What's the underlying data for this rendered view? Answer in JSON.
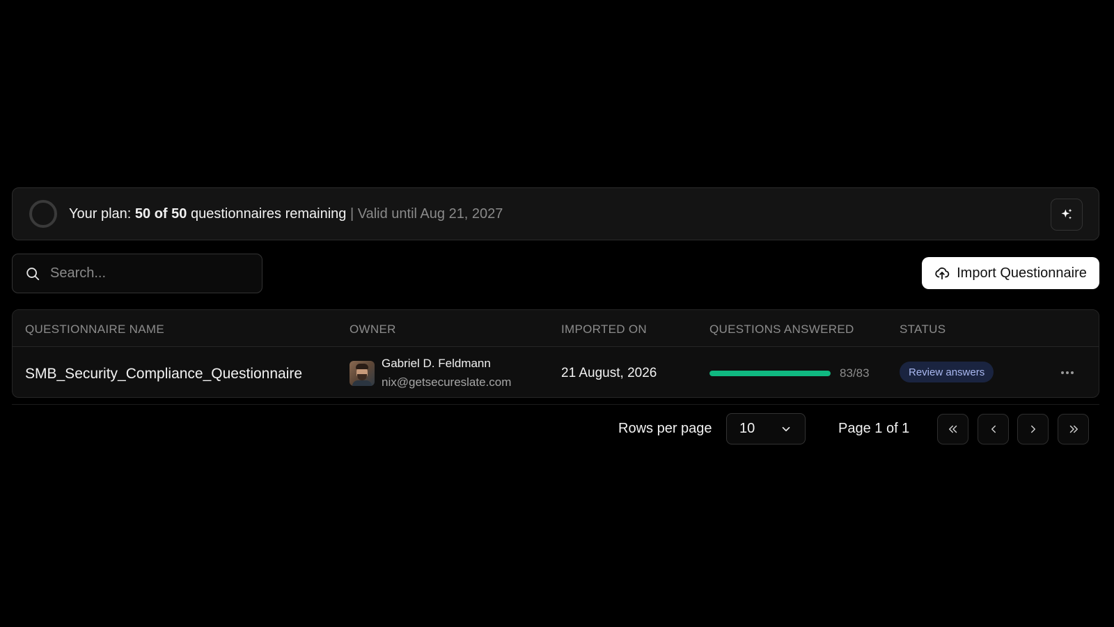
{
  "plan": {
    "prefix": "Your plan: ",
    "count": "50 of 50",
    "suffix": " questionnaires remaining",
    "separator": " | ",
    "valid": "Valid until Aug 21, 2027",
    "action_icon": "sparkle-icon"
  },
  "search": {
    "placeholder": "Search...",
    "value": "",
    "icon": "search-icon"
  },
  "import_button": {
    "label": "Import Questionnaire",
    "icon": "cloud-upload-icon"
  },
  "table": {
    "columns": [
      "QUESTIONNAIRE NAME",
      "OWNER",
      "IMPORTED ON",
      "QUESTIONS ANSWERED",
      "STATUS"
    ],
    "rows": [
      {
        "name": "SMB_Security_Compliance_Questionnaire",
        "owner_name": "Gabriel D. Feldmann",
        "owner_email": "nix@getsecureslate.com",
        "imported_on": "21 August, 2026",
        "answered_text": "83/83",
        "answered_fraction": 1.0,
        "status": "Review answers"
      }
    ]
  },
  "pagination": {
    "rows_label": "Rows per page",
    "rows_value": "10",
    "page_info": "Page 1 of 1"
  },
  "colors": {
    "background": "#000000",
    "progress": "#10b981",
    "badge_bg": "#1a2440",
    "badge_text": "#a9b8f0"
  }
}
